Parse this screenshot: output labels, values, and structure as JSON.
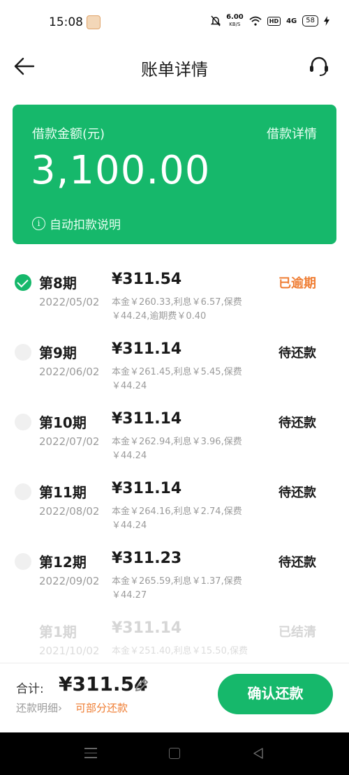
{
  "status_bar": {
    "time": "15:08",
    "net_speed": "6.00",
    "net_unit": "KB/S",
    "hd": "HD",
    "network": "4G",
    "battery": "58"
  },
  "header": {
    "title": "账单详情",
    "back_icon": "arrow-left-icon",
    "support_icon": "headset-icon"
  },
  "card": {
    "label": "借款金额(元)",
    "detail_link": "借款详情",
    "amount": "3,100.00",
    "note": "自动扣款说明",
    "info_icon": "i",
    "color": "#16b86b"
  },
  "installments": [
    {
      "period": "第8期",
      "date": "2022/05/02",
      "amount": "¥311.54",
      "breakdown": "本金￥260.33,利息￥6.57,保费￥44.24,逾期费￥0.40",
      "status": "已逾期",
      "checked": true
    },
    {
      "period": "第9期",
      "date": "2022/06/02",
      "amount": "¥311.14",
      "breakdown": "本金￥261.45,利息￥5.45,保费￥44.24",
      "status": "待还款",
      "checked": false
    },
    {
      "period": "第10期",
      "date": "2022/07/02",
      "amount": "¥311.14",
      "breakdown": "本金￥262.94,利息￥3.96,保费￥44.24",
      "status": "待还款",
      "checked": false
    },
    {
      "period": "第11期",
      "date": "2022/08/02",
      "amount": "¥311.14",
      "breakdown": "本金￥264.16,利息￥2.74,保费￥44.24",
      "status": "待还款",
      "checked": false
    },
    {
      "period": "第12期",
      "date": "2022/09/02",
      "amount": "¥311.23",
      "breakdown": "本金￥265.59,利息￥1.37,保费￥44.27",
      "status": "待还款",
      "checked": false
    },
    {
      "period": "第1期",
      "date": "2021/10/02",
      "amount": "¥311.14",
      "breakdown": "本金￥251.40,利息￥15.50,保费",
      "status": "已结清",
      "checked": false
    }
  ],
  "footer": {
    "total_label": "合计:",
    "total_amount": "¥311.54",
    "detail_link": "还款明细",
    "detail_chevron": "›",
    "partial_link": "可部分还款",
    "confirm_button": "确认还款"
  },
  "colors": {
    "accent": "#16b86b",
    "overdue": "#ef7d33"
  }
}
